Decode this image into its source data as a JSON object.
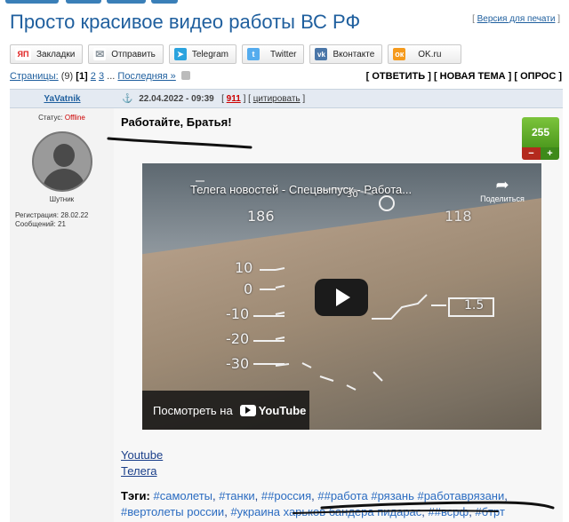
{
  "page": {
    "title": "Просто красивое видео работы ВС РФ",
    "print_link": "Версия для печати"
  },
  "share": [
    {
      "label": "Закладки",
      "icon": "yandex-icon",
      "color": "#e02020",
      "glyph": "ЯП"
    },
    {
      "label": "Отправить",
      "icon": "mail-icon",
      "color": "#9aa4ad",
      "glyph": "✉"
    },
    {
      "label": "Telegram",
      "icon": "telegram-icon",
      "color": "#2aa3de",
      "glyph": "➤"
    },
    {
      "label": "Twitter",
      "icon": "twitter-icon",
      "color": "#55acee",
      "glyph": "t"
    },
    {
      "label": "Вконтакте",
      "icon": "vk-icon",
      "color": "#4a76a8",
      "glyph": "vk"
    },
    {
      "label": "OK.ru",
      "icon": "odnoklassniki-icon",
      "color": "#f59a1c",
      "glyph": "ок"
    }
  ],
  "pagination": {
    "label": "Страницы:",
    "count": "(9)",
    "current": "[1]",
    "p2": "2",
    "p3": "3",
    "ellipsis": "...",
    "last": "Последняя »"
  },
  "actions": "[ ОТВЕТИТЬ ] [ НОВАЯ ТЕМА ] [ ОПРОС ]",
  "post": {
    "author": "YaVatnik",
    "status_label": "Статус:",
    "status_value": "Offline",
    "rank": "Шутник",
    "registration": "Регистрация: 28.02.22",
    "messages": "Сообщений: 21",
    "anchor": "⚓",
    "date": "22.04.2022 - 09:39",
    "number": "911",
    "quote_link": "цитировать",
    "headline": "Работайте, Братья!",
    "rating": "255",
    "rating_minus": "−",
    "rating_plus": "+"
  },
  "video": {
    "title": "Телега новостей - Спецвыпуск - Работа...",
    "share_label": "Поделиться",
    "watch_label": "Посмотреть на",
    "youtube": "YouTube",
    "hud": {
      "speed": "186",
      "alt": "118",
      "t1": "10",
      "t0": "0",
      "m10": "-10",
      "m20": "-20",
      "m30": "-30",
      "val": "1.5",
      "top": "30"
    }
  },
  "links": [
    "Youtube",
    "Телега"
  ],
  "tags": {
    "label": "Тэги:",
    "items": [
      "#самолеты",
      "#танки",
      "##россия",
      "##работа",
      "#рязань",
      "#работаврязани",
      "#вертолеты россии",
      "#украина харьков бандера пидарас",
      "##всрф",
      "#бтрт"
    ]
  }
}
